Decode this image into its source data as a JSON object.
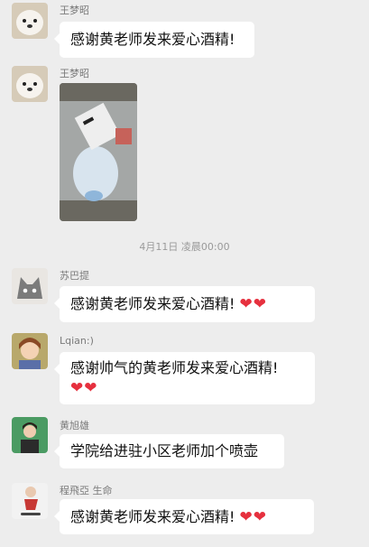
{
  "messages": [
    {
      "sender": "王梦昭",
      "text": "感谢黄老师发来爱心酒精!"
    },
    {
      "sender": "王梦昭",
      "image": "photo-of-alcohol-spray-bottle"
    },
    {
      "sender": "苏巴提",
      "text": "感谢黄老师发来爱心酒精!",
      "hearts": "❤❤"
    },
    {
      "sender": "Lqian:)",
      "text_line1": "感谢帅气的黄老师发来爱心酒精!",
      "hearts": "❤❤"
    },
    {
      "sender": "黄旭雄",
      "text": "学院给进驻小区老师加个喷壶"
    },
    {
      "sender": "程飛亞 生命",
      "text": "感谢黄老师发来爱心酒精!",
      "hearts": "❤❤"
    }
  ],
  "timestamp": "4月11日 凌晨00:00",
  "colors": {
    "background": "#ededed",
    "bubble": "#ffffff",
    "heart": "#e6303e"
  }
}
